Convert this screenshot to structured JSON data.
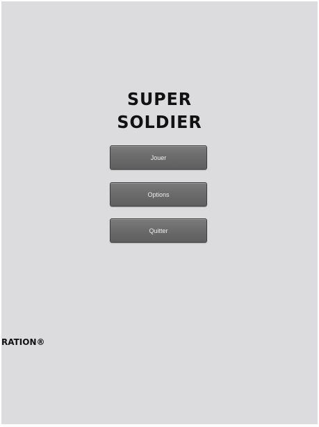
{
  "game": {
    "title_line1": "SUPER",
    "title_line2": "SOLDIER"
  },
  "menu": {
    "play_label": "Jouer",
    "options_label": "Options",
    "quit_label": "Quitter"
  },
  "footer": {
    "text": "RATION®"
  },
  "colors": {
    "background": "#dcdcde",
    "button": "#6c6c6c",
    "button_text": "#eeeeee",
    "title_text": "#111111"
  }
}
